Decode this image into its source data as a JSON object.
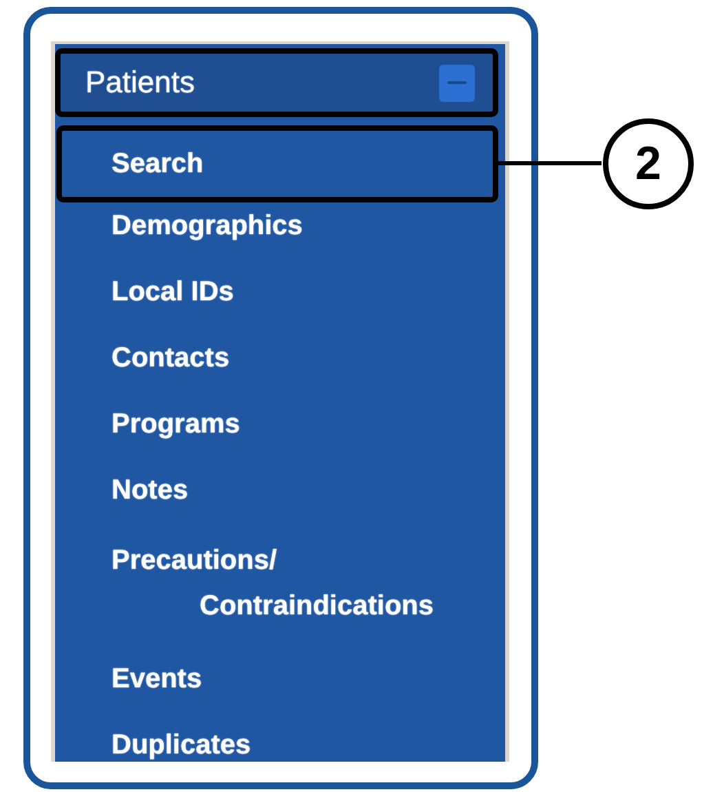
{
  "menu": {
    "header": {
      "label": "Patients",
      "expanded": true,
      "outlined": true
    },
    "items": [
      {
        "label": "Search",
        "outlined": true,
        "callout": "2"
      },
      {
        "label": "Demographics",
        "outlined": false
      },
      {
        "label": "Local IDs",
        "outlined": false
      },
      {
        "label": "Contacts",
        "outlined": false
      },
      {
        "label": "Programs",
        "outlined": false
      },
      {
        "label": "Notes",
        "outlined": false
      },
      {
        "label": "Precautions/\nContraindications",
        "outlined": false
      },
      {
        "label": "Events",
        "outlined": false
      },
      {
        "label": "Duplicates",
        "outlined": false
      }
    ]
  }
}
